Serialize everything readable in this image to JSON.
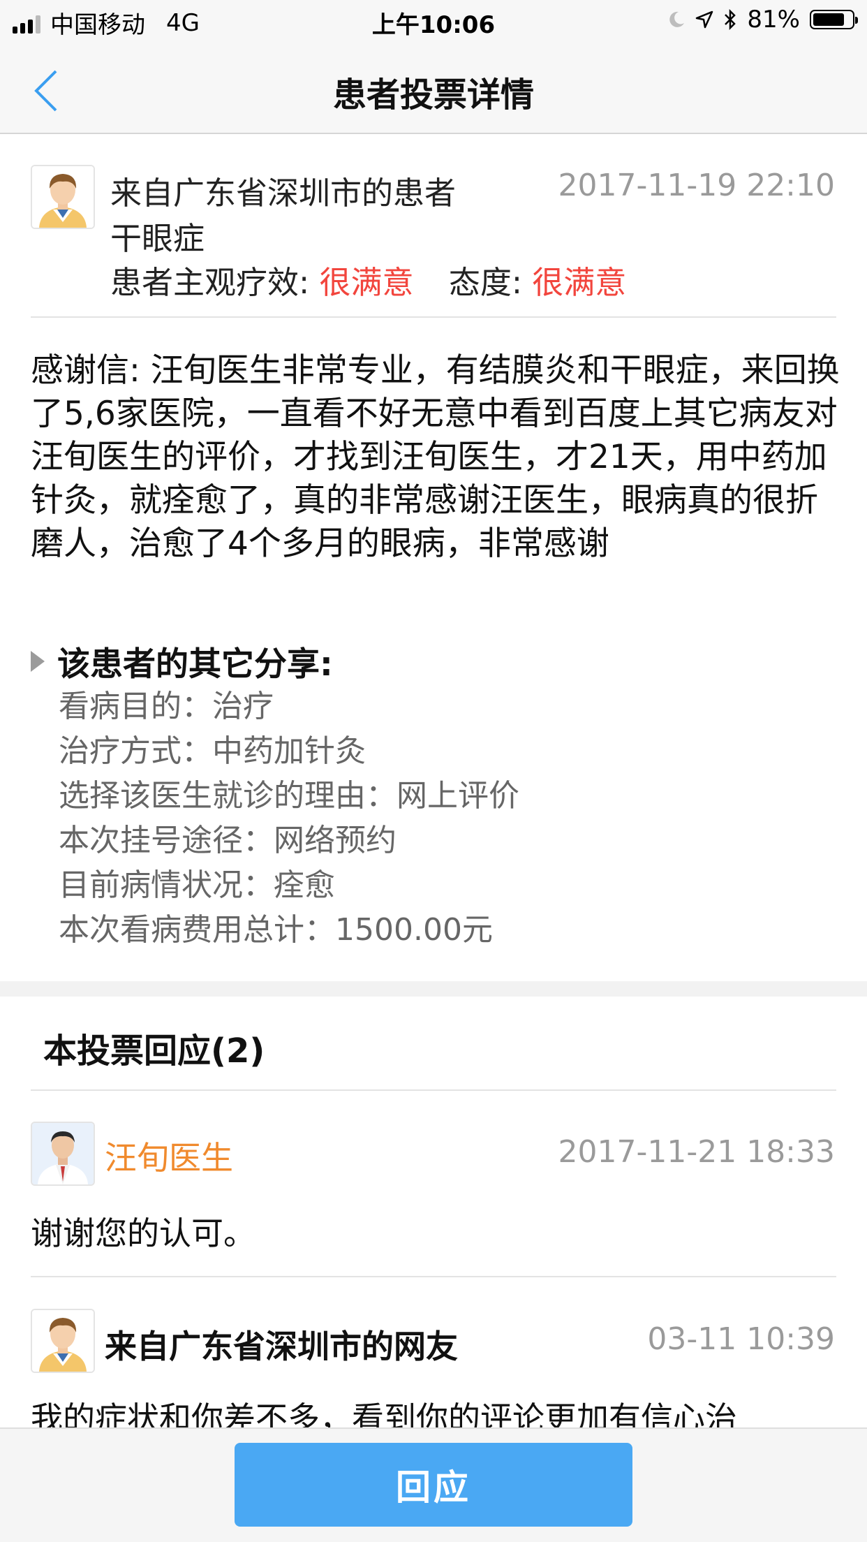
{
  "status_bar": {
    "carrier": "中国移动",
    "network": "4G",
    "time": "上午10:06",
    "battery_percent": "81%",
    "battery_level": 0.81
  },
  "nav": {
    "title": "患者投票详情",
    "back_icon": "chevron-left-icon",
    "accent_color": "#3a9ef0"
  },
  "vote": {
    "from": "来自广东省深圳市的患者",
    "date": "2017-11-19 22:10",
    "disease": "干眼症",
    "effect_label": "患者主观疗效:",
    "effect_value": "很满意",
    "attitude_label": "态度:",
    "attitude_value": "很满意",
    "letter": "感谢信: 汪旬医生非常专业，有结膜炎和干眼症，来回换了5,6家医院，一直看不好无意中看到百度上其它病友对汪旬医生的评价，才找到汪旬医生，才21天，用中药加针灸，就痊愈了，真的非常感谢汪医生，眼病真的很折磨人，治愈了4个多月的眼病，非常感谢"
  },
  "share": {
    "heading": "该患者的其它分享:",
    "items": [
      "看病目的：治疗",
      "治疗方式：中药加针灸",
      "选择该医生就诊的理由：网上评价",
      "本次挂号途径：网络预约",
      "目前病情状况：痊愈",
      "本次看病费用总计：1500.00元"
    ]
  },
  "responses": {
    "title": "本投票回应(2)",
    "items": [
      {
        "name": "汪旬医生",
        "date": "2017-11-21 18:33",
        "text": "谢谢您的认可。"
      },
      {
        "name": "来自广东省深圳市的网友",
        "date": "03-11 10:39",
        "text": "我的症状和你差不多，看到你的评论更加有信心治"
      }
    ]
  },
  "bottom": {
    "reply_label": "回应",
    "button_color": "#4aa8f3"
  }
}
